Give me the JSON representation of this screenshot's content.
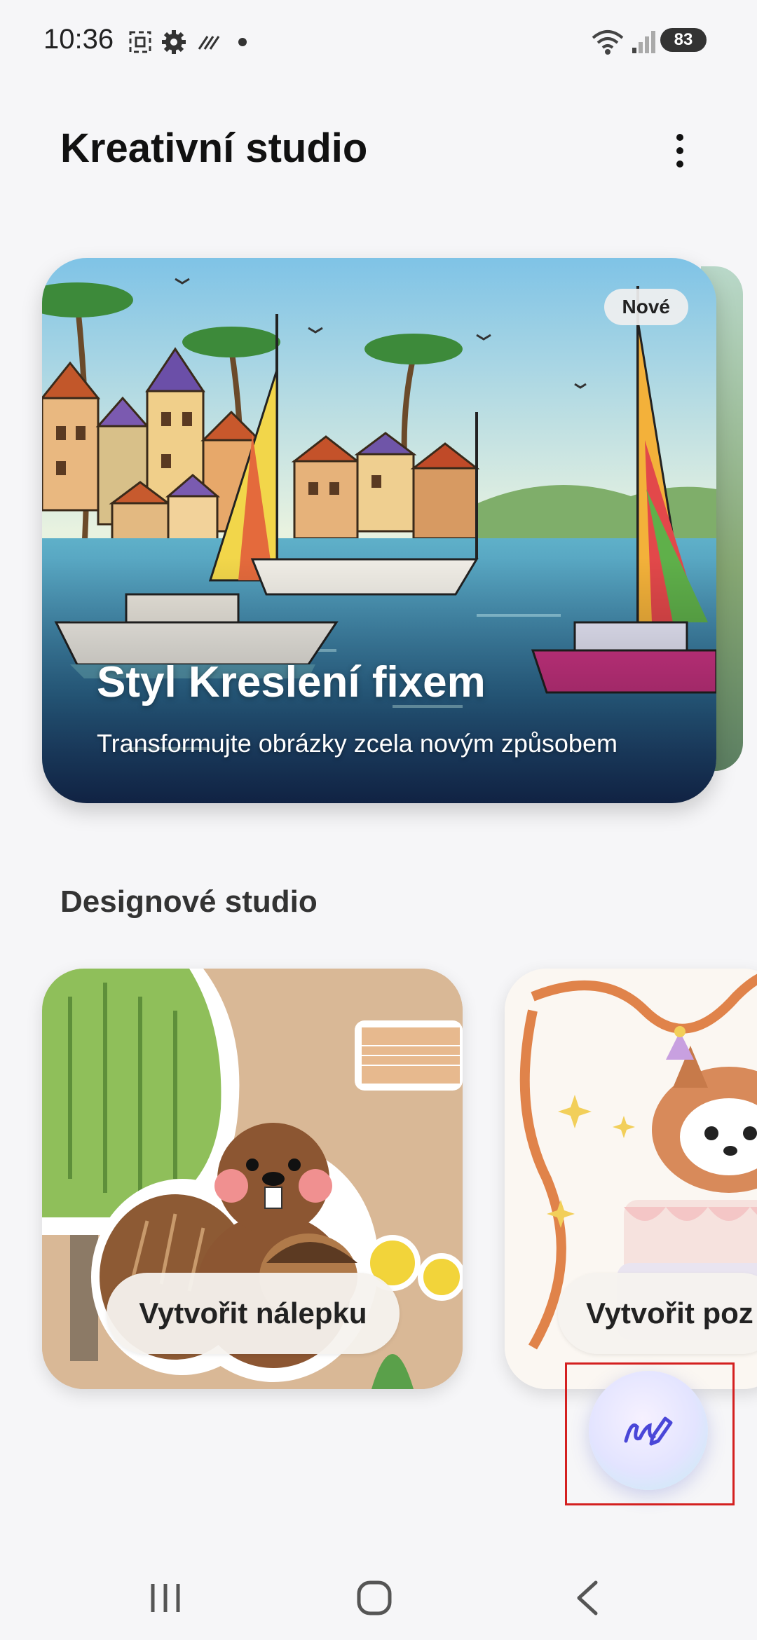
{
  "status": {
    "time": "10:36",
    "battery": "83"
  },
  "header": {
    "title": "Kreativní studio"
  },
  "hero": {
    "badge": "Nové",
    "title": "Styl Kreslení fixem",
    "subtitle": "Transformujte obrázky zcela novým způsobem"
  },
  "design_studio": {
    "title": "Designové studio",
    "tiles": [
      {
        "label": "Vytvořit nálepku"
      },
      {
        "label": "Vytvořit poz"
      }
    ]
  },
  "colors": {
    "accent_fab": "#4a47d8",
    "highlight": "#d42020"
  }
}
